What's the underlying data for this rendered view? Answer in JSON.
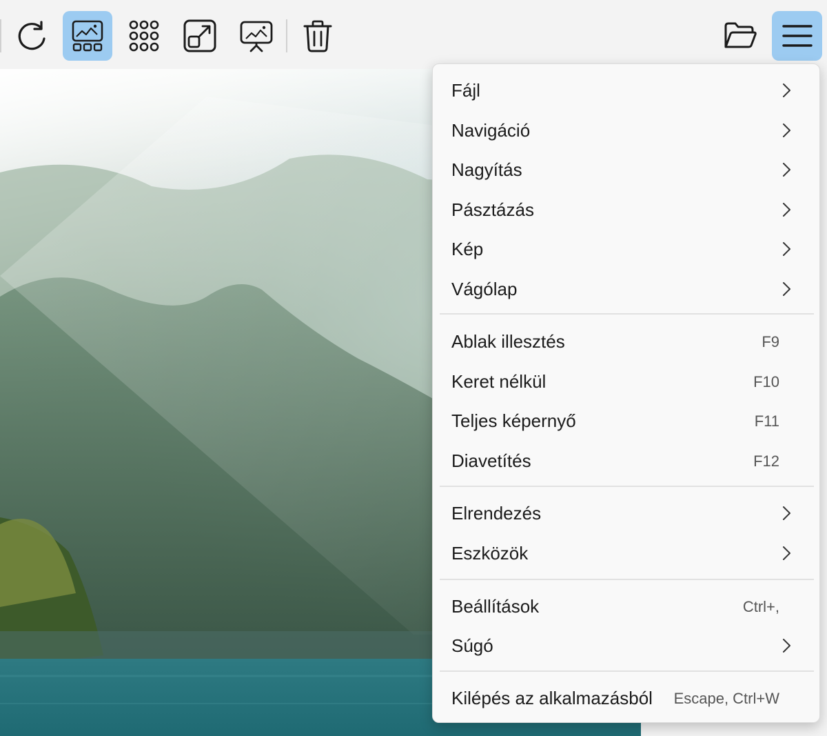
{
  "toolbar": {
    "buttons": [
      {
        "name": "refresh-button",
        "icon": "refresh-icon"
      },
      {
        "name": "gallery-view-button",
        "icon": "gallery-icon",
        "active": true
      },
      {
        "name": "thumbnail-grid-button",
        "icon": "grid-icon"
      },
      {
        "name": "open-new-window-button",
        "icon": "external-window-icon"
      },
      {
        "name": "slideshow-button",
        "icon": "slideshow-icon"
      },
      {
        "name": "delete-button",
        "icon": "trash-icon"
      },
      {
        "name": "open-folder-button",
        "icon": "folder-open-icon"
      },
      {
        "name": "main-menu-button",
        "icon": "hamburger-icon",
        "active": true
      }
    ]
  },
  "menu": {
    "items": [
      {
        "label": "Fájl",
        "submenu": true
      },
      {
        "label": "Navigáció",
        "submenu": true
      },
      {
        "label": "Nagyítás",
        "submenu": true
      },
      {
        "label": "Pásztázás",
        "submenu": true
      },
      {
        "label": "Kép",
        "submenu": true
      },
      {
        "label": "Vágólap",
        "submenu": true
      },
      {
        "label": "Ablak illesztés",
        "shortcut": "F9"
      },
      {
        "label": "Keret nélkül",
        "shortcut": "F10"
      },
      {
        "label": "Teljes képernyő",
        "shortcut": "F11"
      },
      {
        "label": "Diavetítés",
        "shortcut": "F12"
      },
      {
        "label": "Elrendezés",
        "submenu": true
      },
      {
        "label": "Eszközök",
        "submenu": true
      },
      {
        "label": "Beállítások",
        "shortcut": "Ctrl+,"
      },
      {
        "label": "Súgó",
        "submenu": true
      },
      {
        "label": "Kilépés az alkalmazásból",
        "shortcut": "Escape, Ctrl+W"
      }
    ]
  },
  "colors": {
    "accent": "#9ccbf1",
    "menu_bg": "#f9f9f9",
    "toolbar_bg": "#f3f3f3"
  }
}
